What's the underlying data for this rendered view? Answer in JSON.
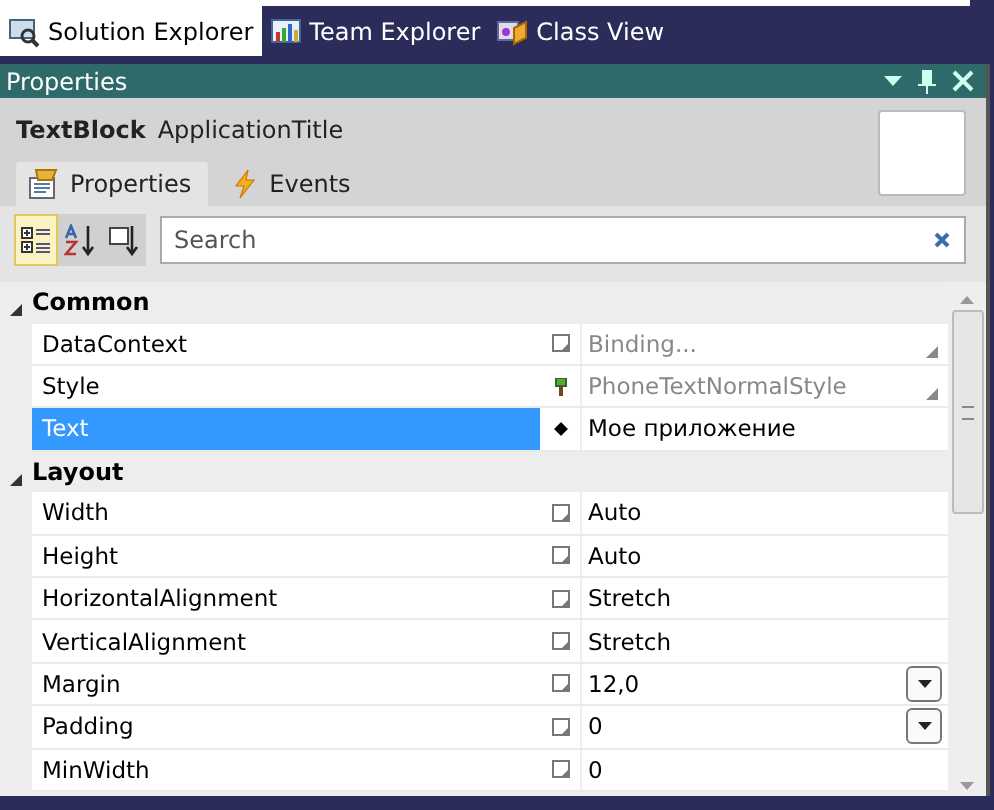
{
  "doc_tabs": [
    {
      "label": "Solution Explorer",
      "selected": true
    },
    {
      "label": "Team Explorer",
      "selected": false
    },
    {
      "label": "Class View",
      "selected": false
    }
  ],
  "panel": {
    "title": "Properties"
  },
  "element": {
    "type": "TextBlock",
    "name": "ApplicationTitle"
  },
  "tabs": [
    {
      "label": "Properties",
      "selected": true
    },
    {
      "label": "Events",
      "selected": false
    }
  ],
  "toolbar": [
    {
      "selected": true
    },
    {
      "selected": false
    },
    {
      "selected": false
    }
  ],
  "search": {
    "placeholder": "Search"
  },
  "categories": [
    {
      "name": "Common",
      "expanded": true,
      "rows": [
        {
          "name": "DataContext",
          "kind": "default",
          "value": "Binding...",
          "inherited": true,
          "picker": true,
          "dropdown": false,
          "selected": false
        },
        {
          "name": "Style",
          "kind": "style",
          "value": "PhoneTextNormalStyle",
          "inherited": true,
          "picker": true,
          "dropdown": false,
          "selected": false
        },
        {
          "name": "Text",
          "kind": "local",
          "value": "Мое приложение",
          "inherited": false,
          "picker": false,
          "dropdown": false,
          "selected": true
        }
      ]
    },
    {
      "name": "Layout",
      "expanded": true,
      "rows": [
        {
          "name": "Width",
          "kind": "default",
          "value": "Auto",
          "inherited": false,
          "picker": false,
          "dropdown": false,
          "selected": false
        },
        {
          "name": "Height",
          "kind": "default",
          "value": "Auto",
          "inherited": false,
          "picker": false,
          "dropdown": false,
          "selected": false
        },
        {
          "name": "HorizontalAlignment",
          "kind": "default",
          "value": "Stretch",
          "inherited": false,
          "picker": false,
          "dropdown": false,
          "selected": false
        },
        {
          "name": "VerticalAlignment",
          "kind": "default",
          "value": "Stretch",
          "inherited": false,
          "picker": false,
          "dropdown": false,
          "selected": false
        },
        {
          "name": "Margin",
          "kind": "default",
          "value": "12,0",
          "inherited": false,
          "picker": false,
          "dropdown": true,
          "selected": false
        },
        {
          "name": "Padding",
          "kind": "default",
          "value": "0",
          "inherited": false,
          "picker": false,
          "dropdown": true,
          "selected": false
        },
        {
          "name": "MinWidth",
          "kind": "default",
          "value": "0",
          "inherited": false,
          "picker": false,
          "dropdown": false,
          "selected": false
        }
      ]
    }
  ]
}
